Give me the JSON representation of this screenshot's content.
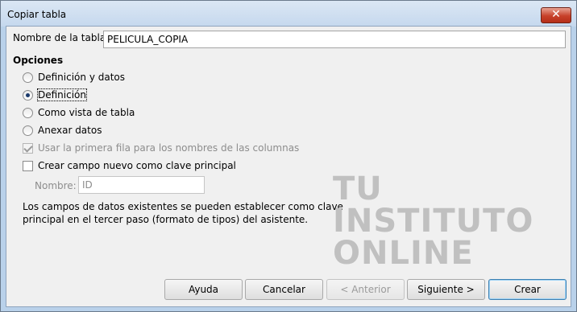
{
  "window": {
    "title": "Copiar tabla",
    "close_glyph": "✕"
  },
  "table_name": {
    "label": "Nombre de la tabla:",
    "value": "PELICULA_COPIA"
  },
  "options": {
    "title": "Opciones",
    "items": [
      {
        "label": "Definición y datos",
        "selected": false
      },
      {
        "label": "Definición",
        "selected": true
      },
      {
        "label": "Como vista de tabla",
        "selected": false
      },
      {
        "label": "Anexar datos",
        "selected": false
      }
    ],
    "use_first_row": {
      "label": "Usar la primera fila para los nombres de las columnas",
      "checked": true,
      "enabled": false
    },
    "create_pk": {
      "label": "Crear campo nuevo como clave principal",
      "checked": false
    }
  },
  "pk_name": {
    "label": "Nombre:",
    "value": "ID"
  },
  "info_text": "Los campos de datos existentes se pueden establecer como clave principal en el tercer paso (formato de tipos) del asistente.",
  "watermark": {
    "line1": "TU",
    "line2": "INSTITUTO",
    "line3": "ONLINE"
  },
  "buttons": {
    "help": "Ayuda",
    "cancel": "Cancelar",
    "previous": "< Anterior",
    "next": "Siguiente >",
    "create": "Crear"
  }
}
